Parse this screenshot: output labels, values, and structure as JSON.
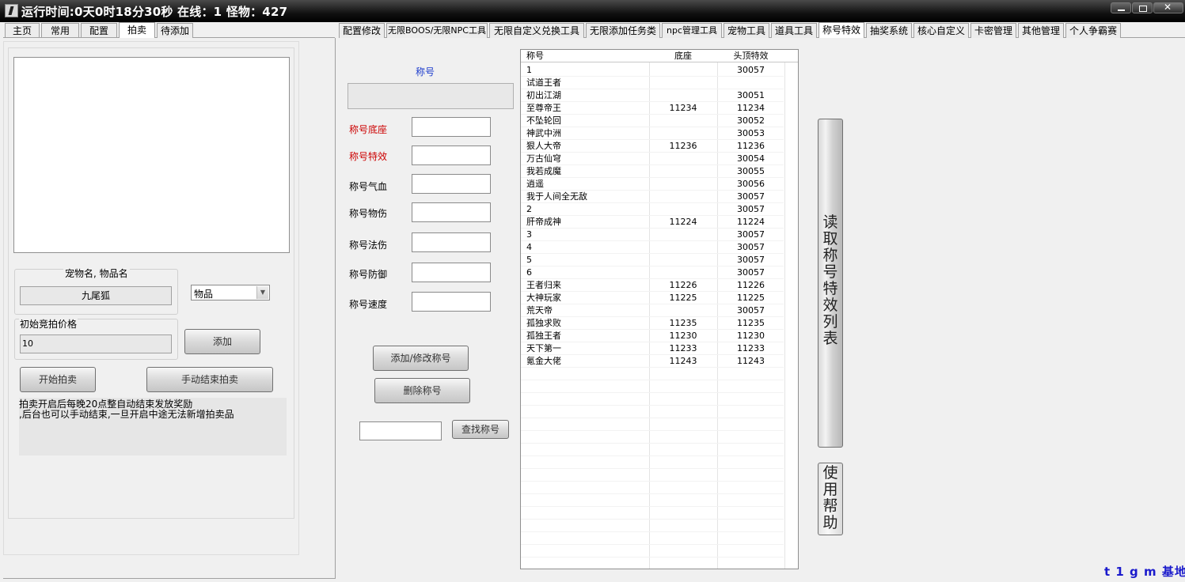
{
  "titlebar": {
    "text": "运行时间:0天0时18分30秒  在线：1  怪物：427"
  },
  "left_tabs": [
    "主页",
    "常用",
    "配置",
    "拍卖",
    "待添加"
  ],
  "right_tabs": [
    "配置修改",
    "无限BOOS/无限NPC工具",
    "无限自定义兑换工具",
    "无限添加任务类",
    "npc管理工具",
    "宠物工具",
    "道具工具",
    "称号特效",
    "抽奖系统",
    "核心自定义",
    "卡密管理",
    "其他管理",
    "个人争霸赛"
  ],
  "auction": {
    "pet_item_label": "宠物名, 物品名",
    "pet_item_value": "九尾狐",
    "type_value": "物品",
    "start_price_label": "初始竞拍价格",
    "start_price_value": "10",
    "add_button": "添加",
    "start_button": "开始拍卖",
    "end_button": "手动结束拍卖",
    "info_line1": "拍卖开启后每晚20点整自动结束发放奖励",
    "info_line2": ",后台也可以手动结束,一旦开启中途无法新增拍卖品"
  },
  "title_form": {
    "name_label": "称号",
    "base_label": "称号底座",
    "effect_label": "称号特效",
    "hp_label": "称号气血",
    "phys_label": "称号物伤",
    "magic_label": "称号法伤",
    "def_label": "称号防御",
    "speed_label": "称号速度",
    "add_modify_button": "添加/修改称号",
    "delete_button": "删除称号",
    "search_button": "查找称号"
  },
  "title_list": {
    "headers": [
      "称号",
      "底座",
      "头顶特效"
    ],
    "rows": [
      [
        "1",
        "",
        "30057"
      ],
      [
        "试道王者",
        "",
        ""
      ],
      [
        "初出江湖",
        "",
        "30051"
      ],
      [
        "至尊帝王",
        "11234",
        "11234"
      ],
      [
        "不坠轮回",
        "",
        "30052"
      ],
      [
        "神武中洲",
        "",
        "30053"
      ],
      [
        "狠人大帝",
        "11236",
        "11236"
      ],
      [
        "万古仙穹",
        "",
        "30054"
      ],
      [
        "我若成魔",
        "",
        "30055"
      ],
      [
        "逍遥",
        "",
        "30056"
      ],
      [
        "我于人间全无敌",
        "",
        "30057"
      ],
      [
        "2",
        "",
        "30057"
      ],
      [
        "肝帝成神",
        "11224",
        "11224"
      ],
      [
        "3",
        "",
        "30057"
      ],
      [
        "4",
        "",
        "30057"
      ],
      [
        "5",
        "",
        "30057"
      ],
      [
        "6",
        "",
        "30057"
      ],
      [
        "王者归来",
        "11226",
        "11226"
      ],
      [
        "大神玩家",
        "11225",
        "11225"
      ],
      [
        "荒天帝",
        "",
        "30057"
      ],
      [
        "孤独求败",
        "11235",
        "11235"
      ],
      [
        "孤独王者",
        "11230",
        "11230"
      ],
      [
        "天下第一",
        "11233",
        "11233"
      ],
      [
        "氪金大佬",
        "11243",
        "11243"
      ]
    ]
  },
  "side": {
    "read_button": "读取称号特效列表",
    "help_button": "使用帮助"
  },
  "footer": {
    "brand": "t 1 g m 基地"
  }
}
